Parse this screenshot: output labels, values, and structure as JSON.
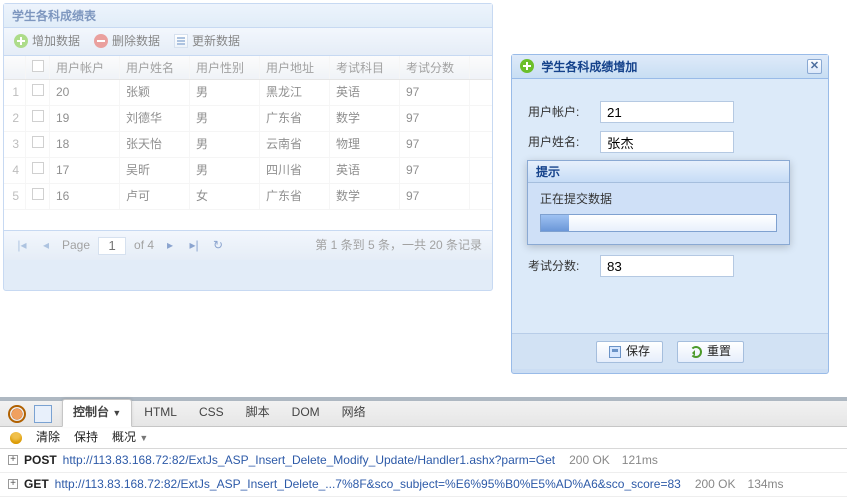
{
  "grid": {
    "title": "学生各科成绩表",
    "toolbar": {
      "add": "增加数据",
      "del": "删除数据",
      "upd": "更新数据"
    },
    "columns": [
      "用户帐户",
      "用户姓名",
      "用户性别",
      "用户地址",
      "考试科目",
      "考试分数"
    ],
    "rows": [
      {
        "n": "1",
        "c": [
          "20",
          "张颖",
          "男",
          "黑龙江",
          "英语",
          "97"
        ]
      },
      {
        "n": "2",
        "c": [
          "19",
          "刘德华",
          "男",
          "广东省",
          "数学",
          "97"
        ]
      },
      {
        "n": "3",
        "c": [
          "18",
          "张天怡",
          "男",
          "云南省",
          "物理",
          "97"
        ]
      },
      {
        "n": "4",
        "c": [
          "17",
          "吴昕",
          "男",
          "四川省",
          "英语",
          "97"
        ]
      },
      {
        "n": "5",
        "c": [
          "16",
          "卢可",
          "女",
          "广东省",
          "数学",
          "97"
        ]
      }
    ],
    "pager": {
      "pageLabel": "Page",
      "page": "1",
      "of": "of 4",
      "info": "第 1 条到 5 条，一共 20 条记录"
    }
  },
  "form": {
    "title": "学生各科成绩增加",
    "fields": {
      "account": "用户帐户:",
      "name": "用户姓名:",
      "score": "考试分数:"
    },
    "values": {
      "account": "21",
      "name": "张杰",
      "score": "83"
    },
    "buttons": {
      "save": "保存",
      "reset": "重置"
    }
  },
  "progress": {
    "title": "提示",
    "text": "正在提交数据"
  },
  "devtools": {
    "tabs": [
      "控制台",
      "HTML",
      "CSS",
      "脚本",
      "DOM",
      "网络"
    ],
    "sub": {
      "clear": "清除",
      "keep": "保持",
      "overview": "概况"
    },
    "reqs": [
      {
        "method": "POST",
        "url": "http://113.83.168.72:82/ExtJs_ASP_Insert_Delete_Modify_Update/Handler1.ashx?parm=Get",
        "status": "200 OK",
        "time": "121ms"
      },
      {
        "method": "GET",
        "url": "http://113.83.168.72:82/ExtJs_ASP_Insert_Delete_...7%8F&sco_subject=%E6%95%B0%E5%AD%A6&sco_score=83",
        "status": "200 OK",
        "time": "134ms"
      }
    ]
  }
}
